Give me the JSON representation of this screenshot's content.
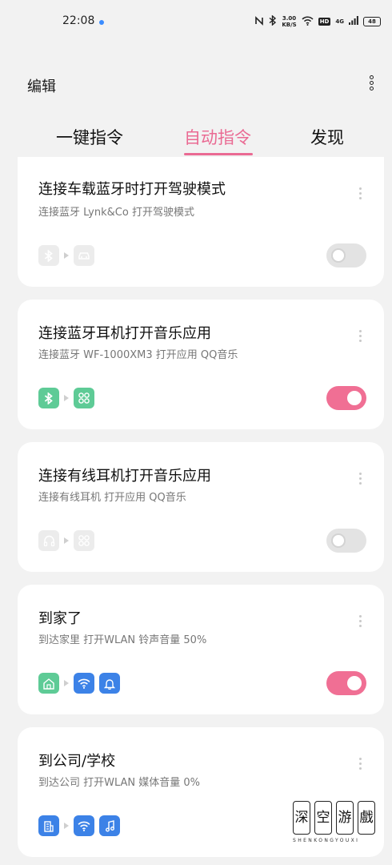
{
  "status_bar": {
    "time": "22:08",
    "speed": "3.00",
    "speed_unit": "KB/S",
    "hd": "HD",
    "signal": "4G",
    "battery": "48"
  },
  "header": {
    "title": "编辑"
  },
  "tabs": [
    {
      "label": "一键指令",
      "active": false
    },
    {
      "label": "自动指令",
      "active": true
    },
    {
      "label": "发现",
      "active": false
    }
  ],
  "colors": {
    "accent": "#ea6a93",
    "toggle_on": "#f06f94",
    "green": "#5ecb96",
    "blue": "#3c82e7"
  },
  "cards": [
    {
      "title": "连接车载蓝牙时打开驾驶模式",
      "desc": "连接蓝牙 Lynk&Co  打开驾驶模式",
      "icons": [
        "bluetooth-icon",
        "car-icon"
      ],
      "enabled": false
    },
    {
      "title": "连接蓝牙耳机打开音乐应用",
      "desc": "连接蓝牙 WF-1000XM3  打开应用 QQ音乐",
      "icons": [
        "bluetooth-icon",
        "apps-icon"
      ],
      "enabled": true
    },
    {
      "title": "连接有线耳机打开音乐应用",
      "desc": "连接有线耳机  打开应用 QQ音乐",
      "icons": [
        "headphones-icon",
        "apps-icon"
      ],
      "enabled": false
    },
    {
      "title": "到家了",
      "desc": "到达家里  打开WLAN  铃声音量 50%",
      "icons": [
        "home-icon",
        "wifi-icon",
        "bell-icon"
      ],
      "enabled": true
    },
    {
      "title": "到公司/学校",
      "desc": "到达公司  打开WLAN  媒体音量 0%",
      "icons": [
        "office-icon",
        "wifi-icon",
        "music-note-icon"
      ],
      "enabled": null
    }
  ],
  "watermark": {
    "chars": [
      "深",
      "空",
      "游",
      "戲"
    ],
    "sub": "SHENKONGYOUXI"
  }
}
